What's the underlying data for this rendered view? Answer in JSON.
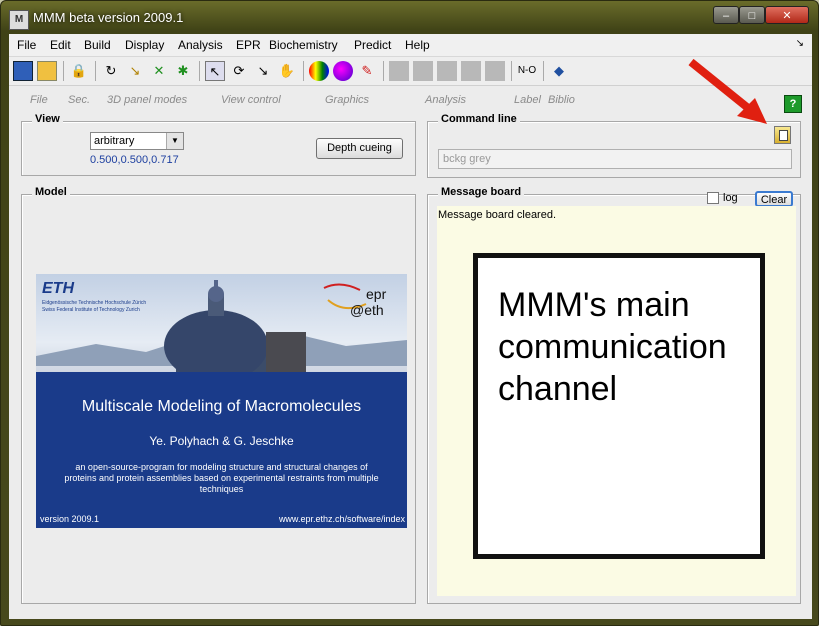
{
  "window": {
    "title": "MMM beta version 2009.1",
    "min": "–",
    "max": "□",
    "close": "✕"
  },
  "menu": [
    "File",
    "Edit",
    "Build",
    "Display",
    "Analysis",
    "EPR",
    "Biochemistry",
    "Predict",
    "Help"
  ],
  "panel_tabs": [
    "File",
    "Sec.",
    "3D panel modes",
    "View control",
    "Graphics",
    "Analysis",
    "Label",
    "Biblio"
  ],
  "view": {
    "title": "View",
    "select_value": "arbitrary",
    "coords": "0.500,0.500,0.717",
    "depth_button": "Depth cueing"
  },
  "command": {
    "title": "Command line",
    "input_value": "bckg grey"
  },
  "model": {
    "title": "Model"
  },
  "message": {
    "title": "Message board",
    "log_label": "log",
    "clear_button": "Clear",
    "text": "Message board cleared.",
    "annotation": "MMM's main communication channel"
  },
  "banner": {
    "eth": "ETH",
    "eth_sub1": "Eidgenössische Technische Hochschule Zürich",
    "eth_sub2": "Swiss Federal Institute of Technology Zurich",
    "epr": "epr",
    "at_eth": "@eth",
    "headline": "Multiscale Modeling of Macromolecules",
    "authors": "Ye. Polyhach & G. Jeschke",
    "description": "an open-source-program for modeling structure and structural changes of proteins and protein assemblies based on experimental restraints from multiple techniques",
    "version": "version 2009.1",
    "url": "www.epr.ethz.ch/software/index"
  },
  "help_icon": "?",
  "colors": {
    "accent_arrow": "#e02010",
    "banner_blue": "#1a3b8a",
    "help_green": "#1d9a2a"
  }
}
